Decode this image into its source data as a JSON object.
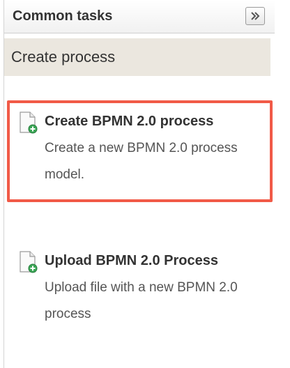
{
  "header": {
    "title": "Common tasks",
    "collapse_icon": "double-chevron-right-icon"
  },
  "section": {
    "title": "Create process"
  },
  "tasks": [
    {
      "icon": "new-document-icon",
      "title": "Create BPMN 2.0 process",
      "description": "Create a new BPMN 2.0 process model."
    },
    {
      "icon": "new-document-icon",
      "title": "Upload BPMN 2.0 Process",
      "description": "Upload file with a new BPMN 2.0 process"
    }
  ],
  "colors": {
    "highlight": "#f15a47",
    "section_bg": "#ebe7df",
    "icon_badge": "#3aa655"
  }
}
